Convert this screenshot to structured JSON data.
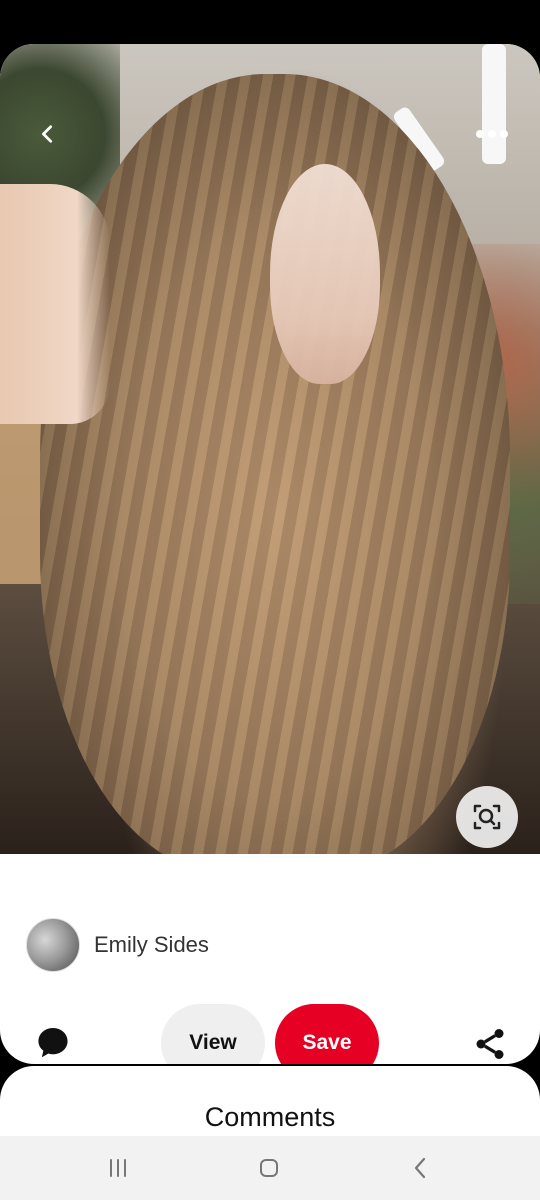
{
  "pin": {
    "image_alt": "Long wavy bronde balayage hair"
  },
  "author": {
    "name": "Emily Sides"
  },
  "actions": {
    "view_label": "View",
    "save_label": "Save"
  },
  "comments": {
    "title": "Comments"
  },
  "colors": {
    "save_red": "#e60023",
    "view_gray": "#efefef",
    "nav_bg": "#f2f2f2"
  },
  "icons": {
    "back": "back-icon",
    "more": "more-options-icon",
    "lens": "visual-search-icon",
    "comment": "comment-bubble-icon",
    "share": "share-icon"
  }
}
